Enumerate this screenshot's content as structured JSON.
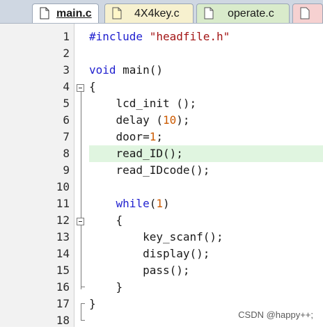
{
  "tabs": [
    {
      "label": "main.c",
      "active": true
    },
    {
      "label": "4X4key.c",
      "active": false
    },
    {
      "label": "operate.c",
      "active": false
    },
    {
      "label": "",
      "active": false
    }
  ],
  "lines": [
    {
      "n": "1",
      "tokens": [
        {
          "t": "#include ",
          "c": "kw"
        },
        {
          "t": "\"headfile.h\"",
          "c": "str"
        }
      ]
    },
    {
      "n": "2",
      "tokens": []
    },
    {
      "n": "3",
      "tokens": [
        {
          "t": "void",
          "c": "kw"
        },
        {
          "t": " main()",
          "c": ""
        }
      ]
    },
    {
      "n": "4",
      "tokens": [
        {
          "t": "{",
          "c": ""
        }
      ]
    },
    {
      "n": "5",
      "tokens": [
        {
          "t": "    lcd_init ();",
          "c": ""
        }
      ]
    },
    {
      "n": "6",
      "tokens": [
        {
          "t": "    delay (",
          "c": ""
        },
        {
          "t": "10",
          "c": "num"
        },
        {
          "t": ");",
          "c": ""
        }
      ]
    },
    {
      "n": "7",
      "tokens": [
        {
          "t": "    door=",
          "c": ""
        },
        {
          "t": "1",
          "c": "num"
        },
        {
          "t": ";",
          "c": ""
        }
      ]
    },
    {
      "n": "8",
      "tokens": [
        {
          "t": "    read_ID();",
          "c": ""
        }
      ],
      "highlight": true
    },
    {
      "n": "9",
      "tokens": [
        {
          "t": "    read_IDcode();",
          "c": ""
        }
      ]
    },
    {
      "n": "10",
      "tokens": []
    },
    {
      "n": "11",
      "tokens": [
        {
          "t": "    ",
          "c": ""
        },
        {
          "t": "while",
          "c": "kw"
        },
        {
          "t": "(",
          "c": ""
        },
        {
          "t": "1",
          "c": "num"
        },
        {
          "t": ")",
          "c": ""
        }
      ]
    },
    {
      "n": "12",
      "tokens": [
        {
          "t": "    {",
          "c": ""
        }
      ]
    },
    {
      "n": "13",
      "tokens": [
        {
          "t": "        key_scanf();",
          "c": ""
        }
      ]
    },
    {
      "n": "14",
      "tokens": [
        {
          "t": "        display();",
          "c": ""
        }
      ]
    },
    {
      "n": "15",
      "tokens": [
        {
          "t": "        pass();",
          "c": ""
        }
      ]
    },
    {
      "n": "16",
      "tokens": [
        {
          "t": "    }",
          "c": ""
        }
      ]
    },
    {
      "n": "17",
      "tokens": [
        {
          "t": "}",
          "c": ""
        }
      ]
    },
    {
      "n": "18",
      "tokens": []
    }
  ],
  "watermark": "CSDN @happy++;"
}
